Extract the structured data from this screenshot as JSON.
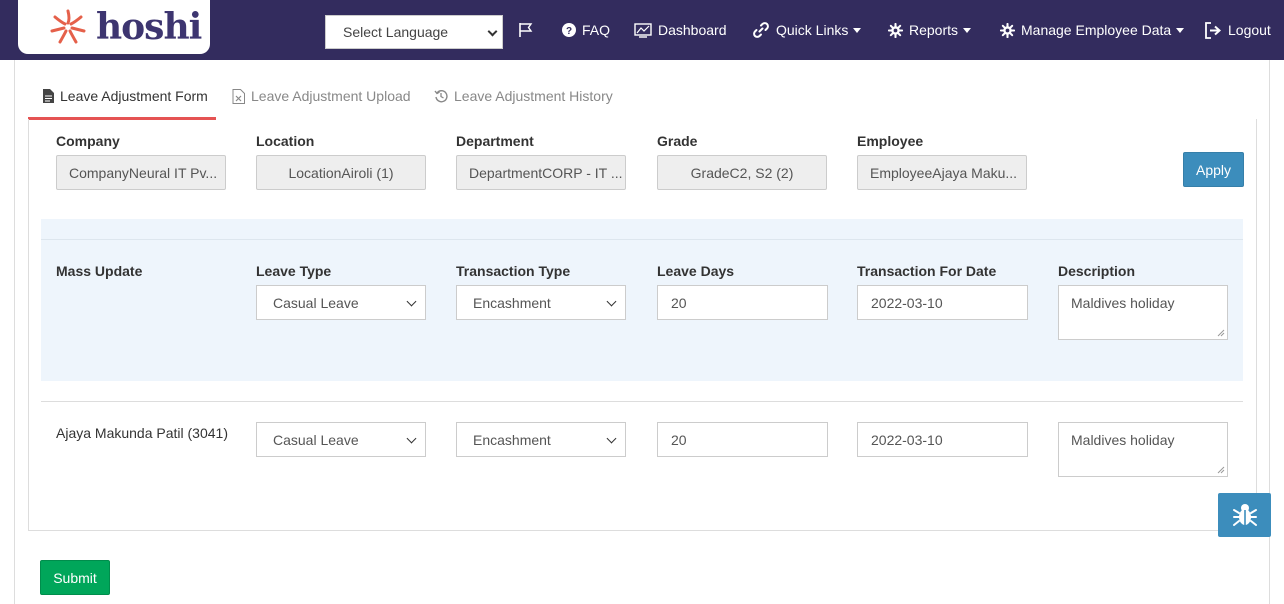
{
  "header": {
    "brand": "hoshi",
    "language_select": "Select Language",
    "nav": {
      "faq": "FAQ",
      "dashboard": "Dashboard",
      "quick_links": "Quick Links",
      "reports": "Reports",
      "manage_employee_data": "Manage Employee Data",
      "logout": "Logout"
    }
  },
  "tabs": [
    {
      "label": "Leave Adjustment Form",
      "icon": "document-icon",
      "active": true
    },
    {
      "label": "Leave Adjustment Upload",
      "icon": "excel-file-icon",
      "active": false
    },
    {
      "label": "Leave Adjustment History",
      "icon": "history-icon",
      "active": false
    }
  ],
  "filters": {
    "company": {
      "label": "Company",
      "value": "CompanyNeural IT Pv..."
    },
    "location": {
      "label": "Location",
      "value": "LocationAiroli (1)"
    },
    "department": {
      "label": "Department",
      "value": "DepartmentCORP - IT ..."
    },
    "grade": {
      "label": "Grade",
      "value": "GradeC2, S2 (2)"
    },
    "employee": {
      "label": "Employee",
      "value": "EmployeeAjaya Maku..."
    },
    "apply_label": "Apply"
  },
  "mass_update": {
    "label": "Mass Update",
    "headers": {
      "leave_type": "Leave Type",
      "transaction_type": "Transaction Type",
      "leave_days": "Leave Days",
      "transaction_for_date": "Transaction For Date",
      "description": "Description"
    },
    "leave_type": "Casual Leave",
    "transaction_type": "Encashment",
    "leave_days": "20",
    "transaction_for_date": "2022-03-10",
    "description": "Maldives holiday"
  },
  "rows": [
    {
      "employee": "Ajaya Makunda Patil (3041)",
      "leave_type": "Casual Leave",
      "transaction_type": "Encashment",
      "leave_days": "20",
      "transaction_for_date": "2022-03-10",
      "description": "Maldives holiday"
    }
  ],
  "submit_label": "Submit",
  "colors": {
    "header_bg": "#332c5e",
    "accent_red": "#e55353",
    "primary_blue": "#3c8dbc",
    "success_green": "#00a65a",
    "mass_row_bg": "#eef5fc"
  }
}
